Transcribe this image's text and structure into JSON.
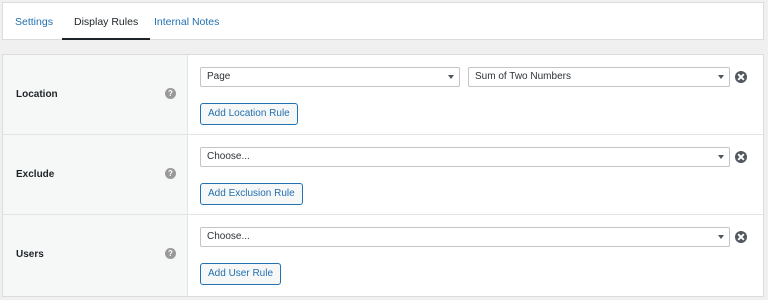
{
  "tabs": [
    {
      "label": "Settings"
    },
    {
      "label": "Display Rules"
    },
    {
      "label": "Internal Notes"
    }
  ],
  "rules": {
    "location": {
      "label": "Location",
      "select_type": "Page",
      "select_value": "Sum of Two Numbers",
      "button": "Add Location Rule"
    },
    "exclude": {
      "label": "Exclude",
      "select_value": "Choose...",
      "button": "Add Exclusion Rule"
    },
    "users": {
      "label": "Users",
      "select_value": "Choose...",
      "button": "Add User Rule"
    }
  },
  "help_glyph": "?",
  "icons": {
    "help": "question-circle",
    "remove": "close-circle",
    "dropdown": "caret-down"
  },
  "colors": {
    "accent": "#2271b1",
    "background": "#f0f0f1",
    "panel": "#ffffff",
    "label_cell": "#f6f7f7",
    "icon": "#50575e"
  }
}
